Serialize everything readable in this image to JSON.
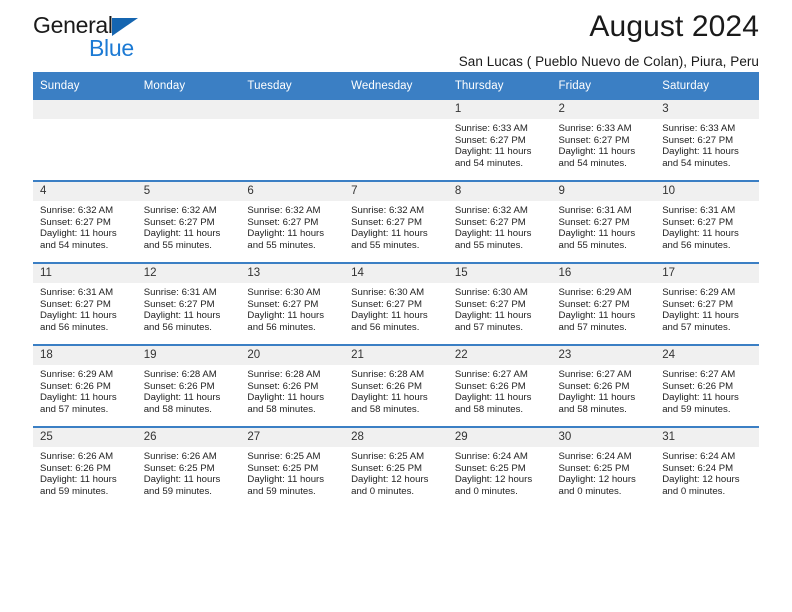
{
  "logo": {
    "word1": "General",
    "word2": "Blue",
    "triangle_color": "#1565b0",
    "blue_color": "#1c7ad4"
  },
  "header": {
    "title": "August 2024",
    "subtitle": "San Lucas ( Pueblo Nuevo de Colan), Piura, Peru"
  },
  "theme": {
    "header_blue": "#3b7fc4",
    "daynum_bg": "#f0f0f0"
  },
  "calendar": {
    "weekday_headers": [
      "Sunday",
      "Monday",
      "Tuesday",
      "Wednesday",
      "Thursday",
      "Friday",
      "Saturday"
    ],
    "weeks": [
      [
        {
          "day": "",
          "empty": true
        },
        {
          "day": "",
          "empty": true
        },
        {
          "day": "",
          "empty": true
        },
        {
          "day": "",
          "empty": true
        },
        {
          "day": "1",
          "sunrise": "Sunrise: 6:33 AM",
          "sunset": "Sunset: 6:27 PM",
          "daylight1": "Daylight: 11 hours",
          "daylight2": "and 54 minutes."
        },
        {
          "day": "2",
          "sunrise": "Sunrise: 6:33 AM",
          "sunset": "Sunset: 6:27 PM",
          "daylight1": "Daylight: 11 hours",
          "daylight2": "and 54 minutes."
        },
        {
          "day": "3",
          "sunrise": "Sunrise: 6:33 AM",
          "sunset": "Sunset: 6:27 PM",
          "daylight1": "Daylight: 11 hours",
          "daylight2": "and 54 minutes."
        }
      ],
      [
        {
          "day": "4",
          "sunrise": "Sunrise: 6:32 AM",
          "sunset": "Sunset: 6:27 PM",
          "daylight1": "Daylight: 11 hours",
          "daylight2": "and 54 minutes."
        },
        {
          "day": "5",
          "sunrise": "Sunrise: 6:32 AM",
          "sunset": "Sunset: 6:27 PM",
          "daylight1": "Daylight: 11 hours",
          "daylight2": "and 55 minutes."
        },
        {
          "day": "6",
          "sunrise": "Sunrise: 6:32 AM",
          "sunset": "Sunset: 6:27 PM",
          "daylight1": "Daylight: 11 hours",
          "daylight2": "and 55 minutes."
        },
        {
          "day": "7",
          "sunrise": "Sunrise: 6:32 AM",
          "sunset": "Sunset: 6:27 PM",
          "daylight1": "Daylight: 11 hours",
          "daylight2": "and 55 minutes."
        },
        {
          "day": "8",
          "sunrise": "Sunrise: 6:32 AM",
          "sunset": "Sunset: 6:27 PM",
          "daylight1": "Daylight: 11 hours",
          "daylight2": "and 55 minutes."
        },
        {
          "day": "9",
          "sunrise": "Sunrise: 6:31 AM",
          "sunset": "Sunset: 6:27 PM",
          "daylight1": "Daylight: 11 hours",
          "daylight2": "and 55 minutes."
        },
        {
          "day": "10",
          "sunrise": "Sunrise: 6:31 AM",
          "sunset": "Sunset: 6:27 PM",
          "daylight1": "Daylight: 11 hours",
          "daylight2": "and 56 minutes."
        }
      ],
      [
        {
          "day": "11",
          "sunrise": "Sunrise: 6:31 AM",
          "sunset": "Sunset: 6:27 PM",
          "daylight1": "Daylight: 11 hours",
          "daylight2": "and 56 minutes."
        },
        {
          "day": "12",
          "sunrise": "Sunrise: 6:31 AM",
          "sunset": "Sunset: 6:27 PM",
          "daylight1": "Daylight: 11 hours",
          "daylight2": "and 56 minutes."
        },
        {
          "day": "13",
          "sunrise": "Sunrise: 6:30 AM",
          "sunset": "Sunset: 6:27 PM",
          "daylight1": "Daylight: 11 hours",
          "daylight2": "and 56 minutes."
        },
        {
          "day": "14",
          "sunrise": "Sunrise: 6:30 AM",
          "sunset": "Sunset: 6:27 PM",
          "daylight1": "Daylight: 11 hours",
          "daylight2": "and 56 minutes."
        },
        {
          "day": "15",
          "sunrise": "Sunrise: 6:30 AM",
          "sunset": "Sunset: 6:27 PM",
          "daylight1": "Daylight: 11 hours",
          "daylight2": "and 57 minutes."
        },
        {
          "day": "16",
          "sunrise": "Sunrise: 6:29 AM",
          "sunset": "Sunset: 6:27 PM",
          "daylight1": "Daylight: 11 hours",
          "daylight2": "and 57 minutes."
        },
        {
          "day": "17",
          "sunrise": "Sunrise: 6:29 AM",
          "sunset": "Sunset: 6:27 PM",
          "daylight1": "Daylight: 11 hours",
          "daylight2": "and 57 minutes."
        }
      ],
      [
        {
          "day": "18",
          "sunrise": "Sunrise: 6:29 AM",
          "sunset": "Sunset: 6:26 PM",
          "daylight1": "Daylight: 11 hours",
          "daylight2": "and 57 minutes."
        },
        {
          "day": "19",
          "sunrise": "Sunrise: 6:28 AM",
          "sunset": "Sunset: 6:26 PM",
          "daylight1": "Daylight: 11 hours",
          "daylight2": "and 58 minutes."
        },
        {
          "day": "20",
          "sunrise": "Sunrise: 6:28 AM",
          "sunset": "Sunset: 6:26 PM",
          "daylight1": "Daylight: 11 hours",
          "daylight2": "and 58 minutes."
        },
        {
          "day": "21",
          "sunrise": "Sunrise: 6:28 AM",
          "sunset": "Sunset: 6:26 PM",
          "daylight1": "Daylight: 11 hours",
          "daylight2": "and 58 minutes."
        },
        {
          "day": "22",
          "sunrise": "Sunrise: 6:27 AM",
          "sunset": "Sunset: 6:26 PM",
          "daylight1": "Daylight: 11 hours",
          "daylight2": "and 58 minutes."
        },
        {
          "day": "23",
          "sunrise": "Sunrise: 6:27 AM",
          "sunset": "Sunset: 6:26 PM",
          "daylight1": "Daylight: 11 hours",
          "daylight2": "and 58 minutes."
        },
        {
          "day": "24",
          "sunrise": "Sunrise: 6:27 AM",
          "sunset": "Sunset: 6:26 PM",
          "daylight1": "Daylight: 11 hours",
          "daylight2": "and 59 minutes."
        }
      ],
      [
        {
          "day": "25",
          "sunrise": "Sunrise: 6:26 AM",
          "sunset": "Sunset: 6:26 PM",
          "daylight1": "Daylight: 11 hours",
          "daylight2": "and 59 minutes."
        },
        {
          "day": "26",
          "sunrise": "Sunrise: 6:26 AM",
          "sunset": "Sunset: 6:25 PM",
          "daylight1": "Daylight: 11 hours",
          "daylight2": "and 59 minutes."
        },
        {
          "day": "27",
          "sunrise": "Sunrise: 6:25 AM",
          "sunset": "Sunset: 6:25 PM",
          "daylight1": "Daylight: 11 hours",
          "daylight2": "and 59 minutes."
        },
        {
          "day": "28",
          "sunrise": "Sunrise: 6:25 AM",
          "sunset": "Sunset: 6:25 PM",
          "daylight1": "Daylight: 12 hours",
          "daylight2": "and 0 minutes."
        },
        {
          "day": "29",
          "sunrise": "Sunrise: 6:24 AM",
          "sunset": "Sunset: 6:25 PM",
          "daylight1": "Daylight: 12 hours",
          "daylight2": "and 0 minutes."
        },
        {
          "day": "30",
          "sunrise": "Sunrise: 6:24 AM",
          "sunset": "Sunset: 6:25 PM",
          "daylight1": "Daylight: 12 hours",
          "daylight2": "and 0 minutes."
        },
        {
          "day": "31",
          "sunrise": "Sunrise: 6:24 AM",
          "sunset": "Sunset: 6:24 PM",
          "daylight1": "Daylight: 12 hours",
          "daylight2": "and 0 minutes."
        }
      ]
    ]
  }
}
